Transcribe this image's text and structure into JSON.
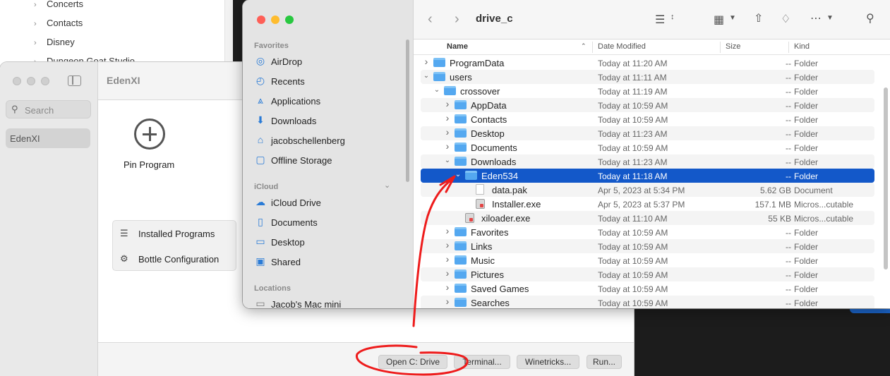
{
  "background_list": {
    "items": [
      "Concerts",
      "Contacts",
      "Disney",
      "Dungeon Goat Studio"
    ]
  },
  "crossover": {
    "title": "EdenXI",
    "search_placeholder": "Search",
    "bottle": "EdenXI",
    "pin_label": "Pin Program",
    "list": [
      {
        "icon": "list-icon",
        "label": "Installed Programs"
      },
      {
        "icon": "gear-icon",
        "label": "Bottle Configuration"
      }
    ],
    "buttons": [
      "Open C: Drive",
      "Terminal...",
      "Winetricks...",
      "Run..."
    ]
  },
  "finder": {
    "title": "drive_c",
    "sidebar": {
      "favorites_header": "Favorites",
      "favorites": [
        {
          "icon": "airdrop-icon",
          "label": "AirDrop"
        },
        {
          "icon": "clock-icon",
          "label": "Recents"
        },
        {
          "icon": "applications-icon",
          "label": "Applications"
        },
        {
          "icon": "download-icon",
          "label": "Downloads"
        },
        {
          "icon": "home-icon",
          "label": "jacobschellenberg"
        },
        {
          "icon": "folder-icon",
          "label": "Offline Storage"
        }
      ],
      "icloud_header": "iCloud",
      "icloud": [
        {
          "icon": "cloud-icon",
          "label": "iCloud Drive"
        },
        {
          "icon": "document-icon",
          "label": "Documents"
        },
        {
          "icon": "desktop-icon",
          "label": "Desktop"
        },
        {
          "icon": "shared-folder-icon",
          "label": "Shared"
        }
      ],
      "locations_header": "Locations",
      "locations": [
        {
          "icon": "computer-icon",
          "label": "Jacob's Mac mini"
        }
      ]
    },
    "columns": {
      "name": "Name",
      "date": "Date Modified",
      "size": "Size",
      "kind": "Kind"
    },
    "rows": [
      {
        "level": 0,
        "chev": "right",
        "type": "folder",
        "name": "ProgramData",
        "date": "Today at 11:20 AM",
        "size": "--",
        "kind": "Folder"
      },
      {
        "level": 0,
        "chev": "down",
        "type": "folder",
        "name": "users",
        "date": "Today at 11:11 AM",
        "size": "--",
        "kind": "Folder"
      },
      {
        "level": 1,
        "chev": "down",
        "type": "folder",
        "name": "crossover",
        "date": "Today at 11:19 AM",
        "size": "--",
        "kind": "Folder"
      },
      {
        "level": 2,
        "chev": "right",
        "type": "folder",
        "name": "AppData",
        "date": "Today at 10:59 AM",
        "size": "--",
        "kind": "Folder"
      },
      {
        "level": 2,
        "chev": "right",
        "type": "folder",
        "name": "Contacts",
        "date": "Today at 10:59 AM",
        "size": "--",
        "kind": "Folder"
      },
      {
        "level": 2,
        "chev": "right",
        "type": "folder",
        "name": "Desktop",
        "date": "Today at 11:23 AM",
        "size": "--",
        "kind": "Folder"
      },
      {
        "level": 2,
        "chev": "right",
        "type": "folder",
        "name": "Documents",
        "date": "Today at 10:59 AM",
        "size": "--",
        "kind": "Folder"
      },
      {
        "level": 2,
        "chev": "down",
        "type": "folder",
        "name": "Downloads",
        "date": "Today at 11:23 AM",
        "size": "--",
        "kind": "Folder"
      },
      {
        "level": 3,
        "chev": "down",
        "type": "folder",
        "name": "Eden534",
        "date": "Today at 11:18 AM",
        "size": "--",
        "kind": "Folder",
        "selected": true
      },
      {
        "level": 4,
        "chev": "",
        "type": "doc",
        "name": "data.pak",
        "date": "Apr 5, 2023 at 5:34 PM",
        "size": "5.62 GB",
        "kind": "Document"
      },
      {
        "level": 4,
        "chev": "",
        "type": "exe",
        "name": "Installer.exe",
        "date": "Apr 5, 2023 at 5:37 PM",
        "size": "157.1 MB",
        "kind": "Micros...cutable"
      },
      {
        "level": 3,
        "chev": "",
        "type": "exe",
        "name": "xiloader.exe",
        "date": "Today at 11:10 AM",
        "size": "55 KB",
        "kind": "Micros...cutable"
      },
      {
        "level": 2,
        "chev": "right",
        "type": "folder",
        "name": "Favorites",
        "date": "Today at 10:59 AM",
        "size": "--",
        "kind": "Folder"
      },
      {
        "level": 2,
        "chev": "right",
        "type": "folder",
        "name": "Links",
        "date": "Today at 10:59 AM",
        "size": "--",
        "kind": "Folder"
      },
      {
        "level": 2,
        "chev": "right",
        "type": "folder",
        "name": "Music",
        "date": "Today at 10:59 AM",
        "size": "--",
        "kind": "Folder"
      },
      {
        "level": 2,
        "chev": "right",
        "type": "folder",
        "name": "Pictures",
        "date": "Today at 10:59 AM",
        "size": "--",
        "kind": "Folder"
      },
      {
        "level": 2,
        "chev": "right",
        "type": "folder",
        "name": "Saved Games",
        "date": "Today at 10:59 AM",
        "size": "--",
        "kind": "Folder"
      },
      {
        "level": 2,
        "chev": "right",
        "type": "folder",
        "name": "Searches",
        "date": "Today at 10:59 AM",
        "size": "--",
        "kind": "Folder"
      }
    ]
  },
  "colors": {
    "selection": "#1358c9",
    "folder": "#54a8f0",
    "annotation": "#ee1c1c",
    "sidebar_icon": "#2a7bd6"
  }
}
